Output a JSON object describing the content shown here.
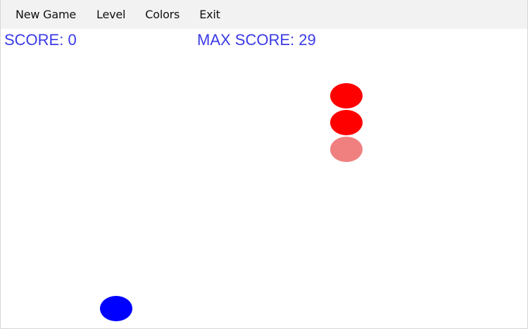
{
  "menu": {
    "items": [
      {
        "label": "New Game"
      },
      {
        "label": "Level"
      },
      {
        "label": "Colors"
      },
      {
        "label": "Exit"
      }
    ]
  },
  "score": {
    "current_text": "SCORE: 0",
    "max_text": "MAX SCORE: 29"
  },
  "colors": {
    "score_text": "#3a3ae6",
    "snake_head": "#ff0000",
    "snake_body": "#ff0000",
    "snake_tail": "#f08080",
    "food": "#0000ff",
    "menubar": "#f2f2f2",
    "background": "#ffffff"
  },
  "game": {
    "snake_segments": [
      {
        "role": "head",
        "color": "#ff0000"
      },
      {
        "role": "body",
        "color": "#ff0000"
      },
      {
        "role": "tail",
        "color": "#f08080"
      }
    ],
    "food": {
      "color": "#0000ff"
    }
  }
}
